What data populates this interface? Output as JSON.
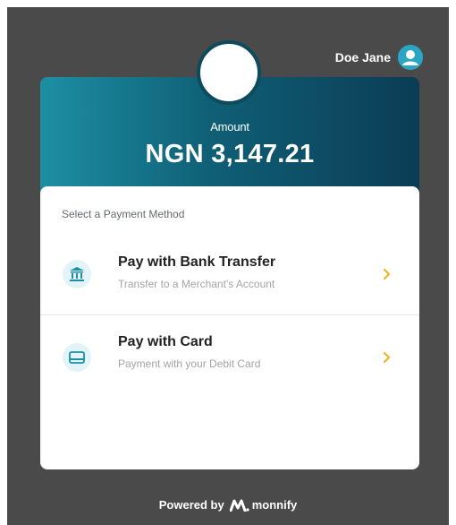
{
  "user": {
    "name": "Doe Jane",
    "avatar_icon": "user-avatar-icon"
  },
  "header": {
    "amount_label": "Amount",
    "amount_value": "NGN 3,147.21"
  },
  "payment": {
    "section_title": "Select a Payment Method",
    "methods": [
      {
        "title": "Pay with Bank Transfer",
        "subtitle": "Transfer to a Merchant's Account",
        "icon": "bank-icon"
      },
      {
        "title": "Pay with Card",
        "subtitle": "Payment with your Debit Card",
        "icon": "card-icon"
      }
    ]
  },
  "footer": {
    "powered_by": "Powered by",
    "brand": "monnify"
  },
  "colors": {
    "background": "#4a4a4a",
    "header_gradient_start": "#1d8fa3",
    "header_gradient_end": "#0b3c55",
    "accent_teal": "#2aa5c4",
    "chevron": "#f2b01e"
  }
}
